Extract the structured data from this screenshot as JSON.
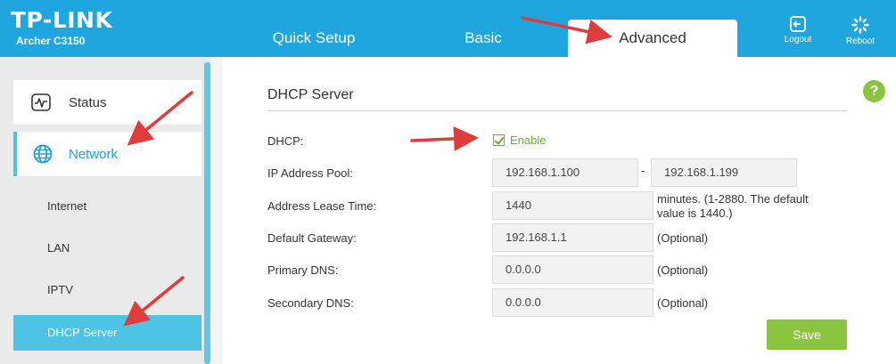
{
  "brand": {
    "logo": "TP-LINK",
    "model": "Archer C3150"
  },
  "nav": {
    "tabs": [
      {
        "label": "Quick Setup"
      },
      {
        "label": "Basic"
      },
      {
        "label": "Advanced"
      }
    ],
    "active": "Advanced"
  },
  "header_actions": {
    "logout": "Logout",
    "reboot": "Reboot"
  },
  "sidebar": {
    "items": [
      {
        "label": "Status",
        "icon": "activity-icon"
      },
      {
        "label": "Network",
        "icon": "globe-icon"
      }
    ],
    "subitems": [
      {
        "label": "Internet"
      },
      {
        "label": "LAN"
      },
      {
        "label": "IPTV"
      },
      {
        "label": "DHCP Server"
      }
    ],
    "active_subitem": "DHCP Server"
  },
  "dhcp": {
    "title": "DHCP Server",
    "help": "?",
    "dhcp_label": "DHCP:",
    "enable_label": "Enable",
    "enabled": true,
    "pool_label": "IP Address Pool:",
    "pool_start": "192.168.1.100",
    "pool_sep": "-",
    "pool_end": "192.168.1.199",
    "lease_label": "Address Lease Time:",
    "lease_value": "1440",
    "lease_note_1": "minutes. (1-2880. The default",
    "lease_note_2": "value is 1440.)",
    "gateway_label": "Default Gateway:",
    "gateway_value": "192.168.1.1",
    "gateway_note": "(Optional)",
    "pdns_label": "Primary DNS:",
    "pdns_value": "0.0.0.0",
    "pdns_note": "(Optional)",
    "sdns_label": "Secondary DNS:",
    "sdns_value": "0.0.0.0",
    "sdns_note": "(Optional)",
    "save": "Save"
  },
  "colors": {
    "header": "#1fa6de",
    "accent": "#4fc3e5",
    "green": "#8bc53f",
    "annotation": "#e03c3c"
  }
}
